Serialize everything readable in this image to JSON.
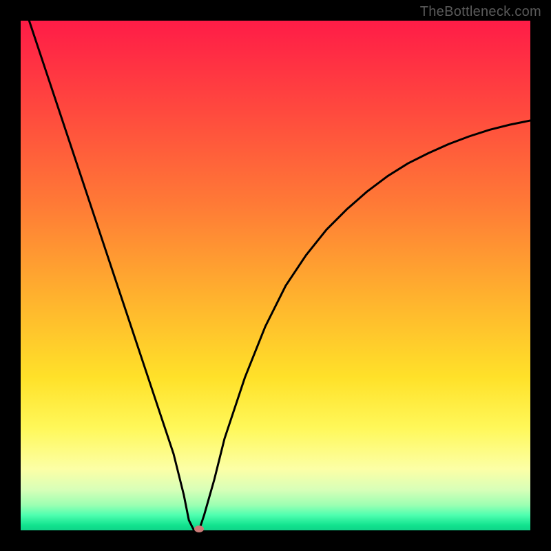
{
  "watermark": "TheBottleneck.com",
  "colors": {
    "frame": "#000000",
    "curve": "#000000",
    "marker": "#cc7a77",
    "gradient_top": "#ff1c47",
    "gradient_bottom": "#0fd488"
  },
  "chart_data": {
    "type": "line",
    "title": "",
    "xlabel": "",
    "ylabel": "",
    "xlim": [
      0,
      100
    ],
    "ylim": [
      0,
      100
    ],
    "series": [
      {
        "name": "bottleneck-curve",
        "x": [
          0,
          2,
          4,
          6,
          8,
          10,
          12,
          14,
          16,
          18,
          20,
          22,
          24,
          26,
          28,
          30,
          32,
          33,
          34,
          35,
          36,
          38,
          40,
          44,
          48,
          52,
          56,
          60,
          64,
          68,
          72,
          76,
          80,
          84,
          88,
          92,
          96,
          100
        ],
        "values": [
          105,
          99,
          93,
          87,
          81,
          75,
          69,
          63,
          57,
          51,
          45,
          39,
          33,
          27,
          21,
          15,
          7,
          2,
          0,
          0,
          3,
          10,
          18,
          30,
          40,
          48,
          54,
          59,
          63,
          66.5,
          69.5,
          72,
          74,
          75.8,
          77.3,
          78.6,
          79.6,
          80.4
        ]
      }
    ],
    "annotations": [
      {
        "name": "optimal-point",
        "x": 35,
        "y": 0
      }
    ]
  }
}
